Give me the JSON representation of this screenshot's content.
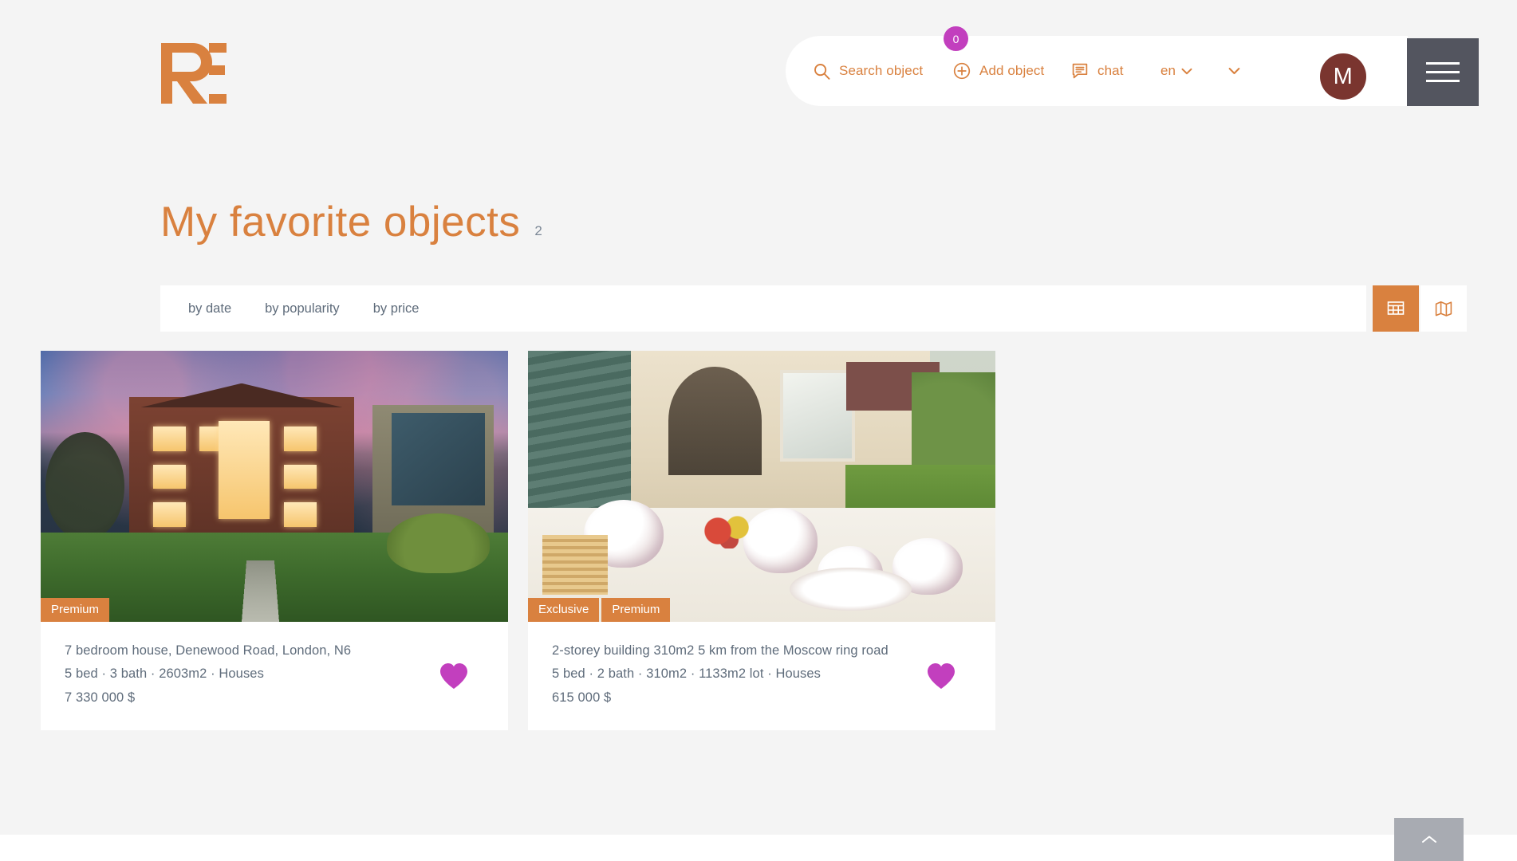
{
  "header": {
    "logo_alt": "RE",
    "nav": [
      {
        "id": "search",
        "label": "Search object",
        "icon": "search-icon"
      },
      {
        "id": "add",
        "label": "Add object",
        "icon": "plus-circle-icon"
      },
      {
        "id": "chat",
        "label": "chat",
        "icon": "chat-icon",
        "badge": "0"
      }
    ],
    "language": {
      "label": "en",
      "icon": "chevron-down-icon"
    },
    "user_caret": "chevron-down-icon",
    "avatar_initial": "M",
    "menu_label": "Menu"
  },
  "title": {
    "text": "My favorite objects",
    "count": "2"
  },
  "filters": {
    "sort_options": [
      {
        "id": "date",
        "label": "by date"
      },
      {
        "id": "popularity",
        "label": "by popularity"
      },
      {
        "id": "price",
        "label": "by price"
      }
    ],
    "views": [
      {
        "id": "grid",
        "icon": "grid-icon",
        "active": true
      },
      {
        "id": "map",
        "icon": "map-icon",
        "active": false
      }
    ]
  },
  "listings": [
    {
      "badges": [
        "Premium"
      ],
      "title": "7 bedroom house, Denewood Road, London, N6",
      "specs": "5 bed · 3 bath · 2603m2 · Houses",
      "price": "7 330 000 $",
      "favorite": true,
      "photo": "house-exterior-dusk"
    },
    {
      "badges": [
        "Exclusive",
        "Premium"
      ],
      "title": "2-storey building 310m2 5 km from the Moscow ring road",
      "specs": "5 bed · 2 bath · 310m2 · 1133m2 lot · Houses",
      "price": "615 000 $",
      "favorite": true,
      "photo": "garden-tea-table"
    }
  ],
  "scroll_top": {
    "icon": "chevron-up-icon",
    "label": "Back to top"
  },
  "colors": {
    "accent": "#d9813f",
    "page_bg": "#f4f4f4",
    "text": "#5f6c7b",
    "favorite": "#c23fbe",
    "avatar_bg": "#7a352f",
    "menu_bg": "#53555f",
    "badge_bg": "#c23fbe",
    "scroll_top_bg": "#a8abb2"
  }
}
